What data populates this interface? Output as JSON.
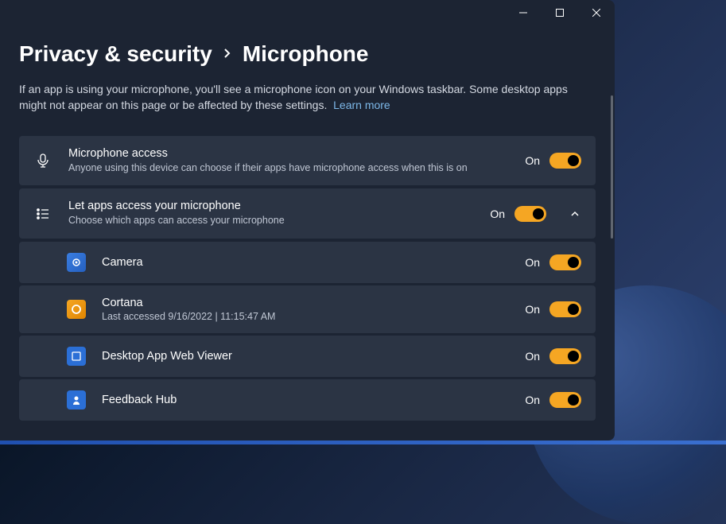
{
  "breadcrumb": {
    "parent": "Privacy & security",
    "current": "Microphone"
  },
  "description": "If an app is using your microphone, you'll see a microphone icon on your Windows taskbar. Some desktop apps might not appear on this page or be affected by these settings.",
  "learn_more": "Learn more",
  "toggles": {
    "on_label": "On"
  },
  "access": {
    "title": "Microphone access",
    "subtitle": "Anyone using this device can choose if their apps have microphone access when this is on"
  },
  "apps_section": {
    "title": "Let apps access your microphone",
    "subtitle": "Choose which apps can access your microphone"
  },
  "apps": [
    {
      "name": "Camera",
      "icon": "camera",
      "meta": ""
    },
    {
      "name": "Cortana",
      "icon": "cortana",
      "meta": "Last accessed 9/16/2022  |  11:15:47 AM"
    },
    {
      "name": "Desktop App Web Viewer",
      "icon": "webviewer",
      "meta": ""
    },
    {
      "name": "Feedback Hub",
      "icon": "feedback",
      "meta": ""
    }
  ]
}
